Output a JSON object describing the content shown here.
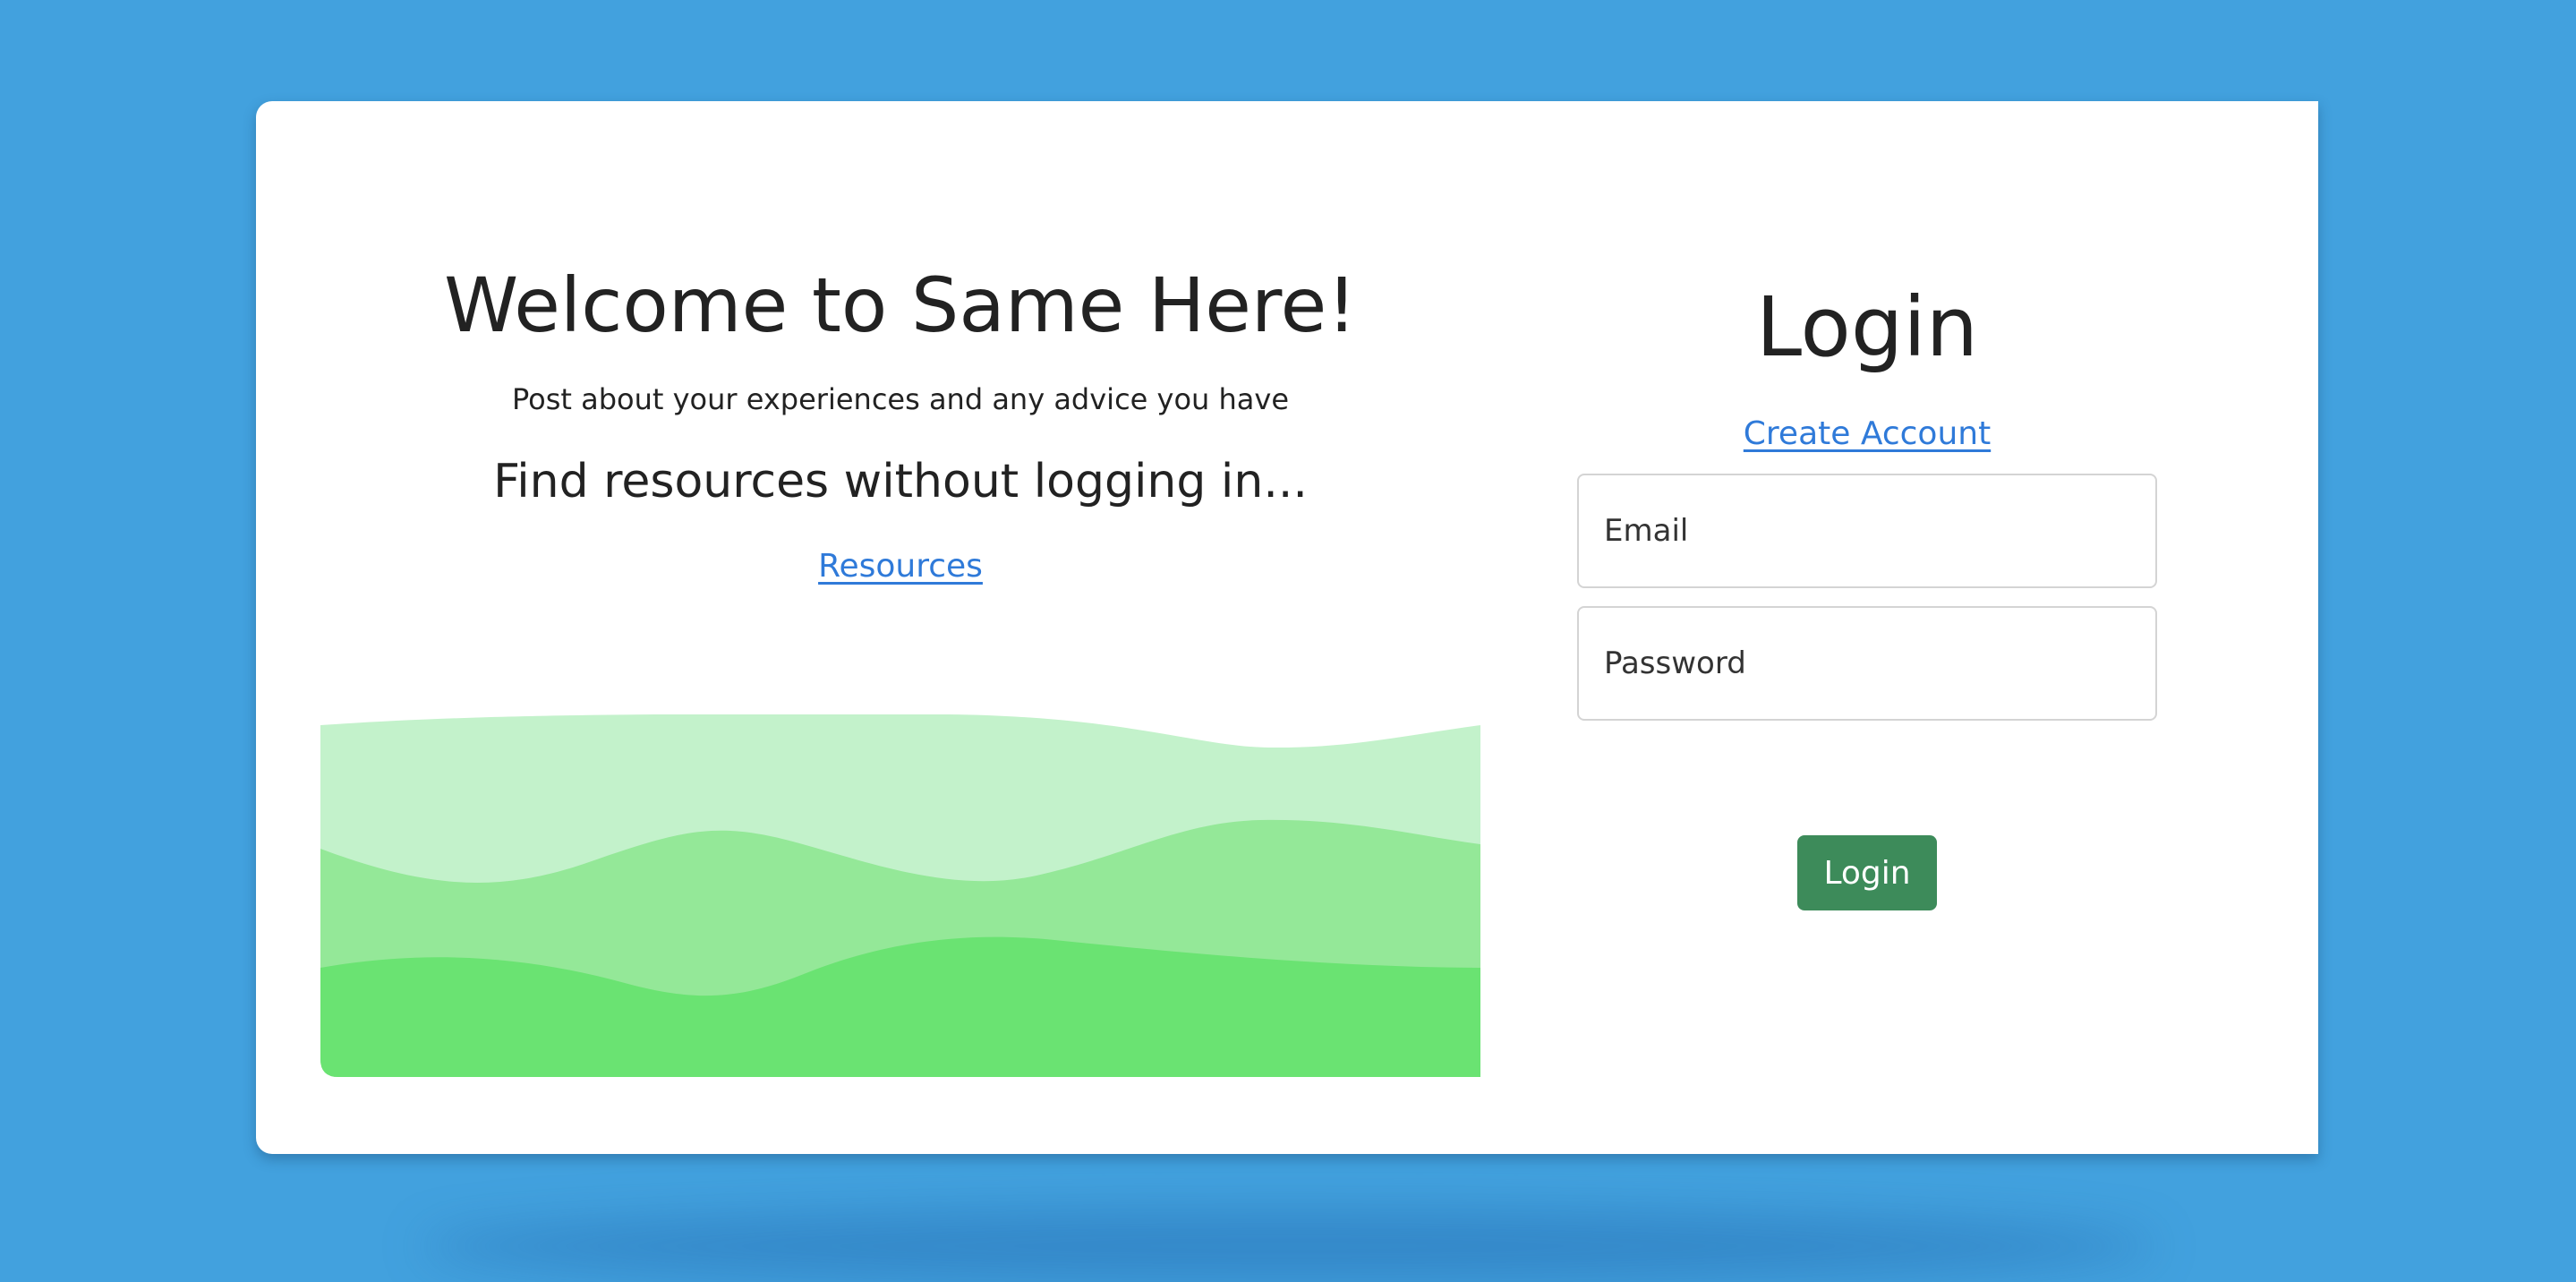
{
  "welcome": {
    "title": "Welcome to Same Here!",
    "tagline": "Post about your experiences and any advice you have",
    "find_text": "Find resources without logging in...",
    "resources_link": "Resources"
  },
  "login": {
    "title": "Login",
    "create_account_link": "Create Account",
    "email_placeholder": "Email",
    "password_placeholder": "Password",
    "submit_label": "Login"
  },
  "colors": {
    "background": "#42a1de",
    "card": "#ffffff",
    "link": "#2f7ad9",
    "button": "#3d8b5a",
    "wave_light": "#c3f2cb",
    "wave_mid": "#94e898",
    "wave_dark": "#6ae372"
  }
}
